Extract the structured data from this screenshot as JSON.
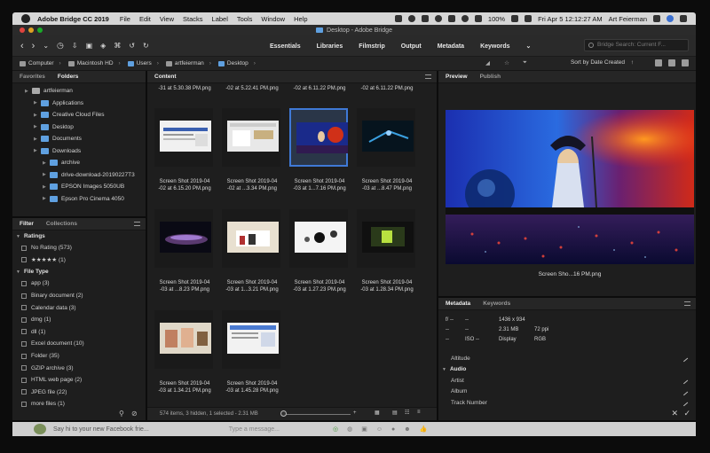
{
  "menubar": {
    "app_name": "Adobe Bridge CC 2019",
    "items": [
      "File",
      "Edit",
      "View",
      "Stacks",
      "Label",
      "Tools",
      "Window",
      "Help"
    ],
    "battery": "100%",
    "clock": "Fri Apr 5  12:12:27 AM",
    "user": "Art Feierman"
  },
  "window": {
    "title": "Desktop - Adobe Bridge"
  },
  "toolbar": {
    "workspaces": [
      "Essentials",
      "Libraries",
      "Filmstrip",
      "Output",
      "Metadata",
      "Keywords"
    ],
    "search_placeholder": "Bridge Search: Current F..."
  },
  "pathbar": {
    "crumbs": [
      "Computer",
      "Macintosh HD",
      "Users",
      "artfeierman",
      "Desktop"
    ],
    "sort_label": "Sort by Date Created"
  },
  "left_panel": {
    "tabs": [
      "Favorites",
      "Folders"
    ],
    "tree": [
      {
        "label": "artfeierman",
        "indent": 1,
        "home": true
      },
      {
        "label": "Applications",
        "indent": 2
      },
      {
        "label": "Creative Cloud Files",
        "indent": 2
      },
      {
        "label": "Desktop",
        "indent": 2
      },
      {
        "label": "Documents",
        "indent": 2
      },
      {
        "label": "Downloads",
        "indent": 2
      },
      {
        "label": "archive",
        "indent": 3
      },
      {
        "label": "drive-download-20190227T3",
        "indent": 3
      },
      {
        "label": "EPSON Images 5050UB",
        "indent": 3
      },
      {
        "label": "Epson Pro Cinema 4050",
        "indent": 3
      }
    ]
  },
  "filter_panel": {
    "tabs": [
      "Filter",
      "Collections"
    ],
    "ratings_head": "Ratings",
    "ratings": [
      "No Rating (573)",
      "★★★★★ (1)"
    ],
    "filetype_head": "File Type",
    "filetypes": [
      "app (3)",
      "Binary document (2)",
      "Calendar data (3)",
      "dmg (1)",
      "dll (1)",
      "Excel document (10)",
      "Folder (35)",
      "GZIP archive (3)",
      "HTML web page (2)",
      "JPEG file (22)",
      "more files (1)"
    ]
  },
  "content": {
    "tab": "Content",
    "partial_labels": [
      "-31 at 5.30.38 PM.png",
      "-02 at 5.22.41 PM.png",
      "-02 at 6.11.22 PM.png",
      "-02 at 6.11.22 PM.png"
    ],
    "items": [
      {
        "l1": "Screen Shot 2019-04",
        "l2": "-02 at 6.15.20 PM.png"
      },
      {
        "l1": "Screen Shot 2019-04",
        "l2": "-02 at ...3.34 PM.png"
      },
      {
        "l1": "Screen Shot 2019-04",
        "l2": "-03 at 1...7.16 PM.png"
      },
      {
        "l1": "Screen Shot 2019-04",
        "l2": "-03 at ...8.47 PM.png"
      },
      {
        "l1": "Screen Shot 2019-04",
        "l2": "-03 at ...8.23 PM.png"
      },
      {
        "l1": "Screen Shot 2019-04",
        "l2": "-03 at 1...3.21 PM.png"
      },
      {
        "l1": "Screen Shot 2019-04",
        "l2": "-03 at 1.27.23 PM.png"
      },
      {
        "l1": "Screen Shot 2019-04",
        "l2": "-03 at 1.28.34 PM.png"
      },
      {
        "l1": "Screen Shot 2019-04",
        "l2": "-03 at 1.34.21 PM.png"
      },
      {
        "l1": "Screen Shot 2019-04",
        "l2": "-03 at 1.45.28 PM.png"
      }
    ],
    "status": "574 items, 3 hidden, 1 selected - 2.31 MB"
  },
  "preview": {
    "tabs": [
      "Preview",
      "Publish"
    ],
    "caption": "Screen Sho...16 PM.png"
  },
  "metadata": {
    "tabs": [
      "Metadata",
      "Keywords"
    ],
    "rows": [
      [
        "f/ --",
        "--",
        "1436 x 934"
      ],
      [
        "--",
        "--",
        "2.31 MB",
        "72 ppi"
      ],
      [
        "--",
        "ISO --",
        "Display",
        "RGB"
      ]
    ],
    "fields": [
      "Altitude",
      "Audio",
      "Artist",
      "Album",
      "Track Number"
    ]
  },
  "dock": {
    "message": "Say hi to your new Facebook frie...",
    "input_placeholder": "Type a message..."
  },
  "colors": {
    "accent": "#3f79d6",
    "panel": "#1e1e1e",
    "folder": "#5fa0e0"
  }
}
